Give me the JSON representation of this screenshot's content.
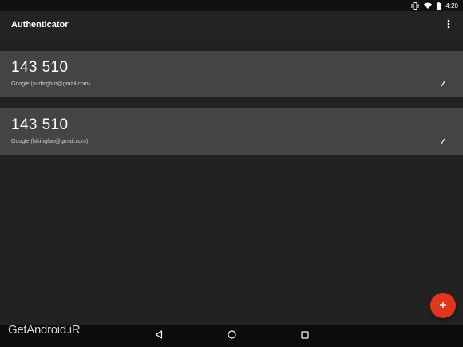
{
  "status_bar": {
    "time": "4:20",
    "icons": [
      "vibrate-icon",
      "wifi-icon",
      "battery-icon"
    ]
  },
  "app_bar": {
    "title": "Authenticator",
    "overflow_icon": "more-vert-icon"
  },
  "accounts": [
    {
      "code": "143 510",
      "label": "Google (surfingfan@gmail.com)"
    },
    {
      "code": "143 510",
      "label": "Google (hikingfan@gmail.com)"
    }
  ],
  "fab": {
    "icon": "add-icon",
    "symbol": "+"
  },
  "nav_bar": {
    "buttons": [
      "back-icon",
      "home-icon",
      "recents-icon"
    ]
  },
  "watermark": {
    "text": "GetAndroid.iR"
  },
  "colors": {
    "background": "#222222",
    "card": "#444444",
    "accent": "#e2351e",
    "status_bar": "#101010",
    "nav_bar": "#0c0c0c"
  }
}
